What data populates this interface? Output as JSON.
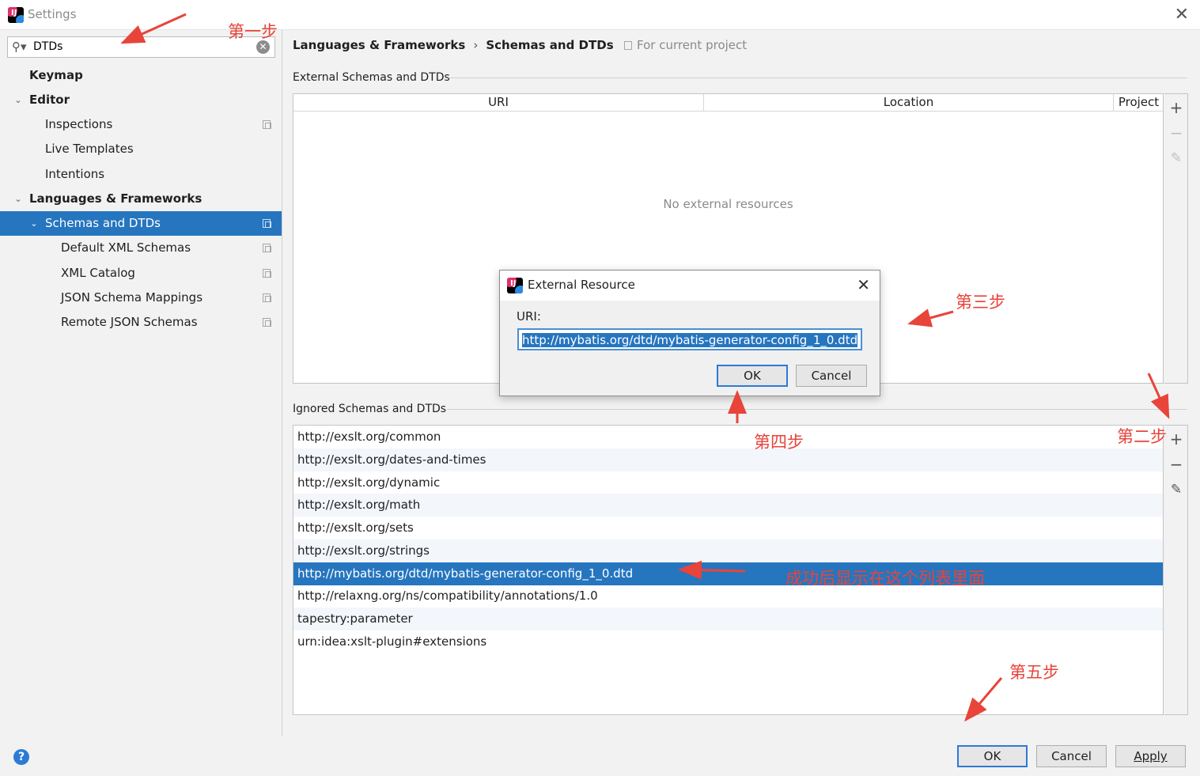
{
  "window": {
    "title": "Settings",
    "app_icon": "intellij-icon",
    "close_icon": "close-icon"
  },
  "sidebar": {
    "search_value": "DTDs",
    "items": [
      {
        "label": "Keymap"
      },
      {
        "label": "Editor"
      },
      {
        "label": "Inspections"
      },
      {
        "label": "Live Templates"
      },
      {
        "label": "Intentions"
      },
      {
        "label": "Languages & Frameworks"
      },
      {
        "label": "Schemas and DTDs"
      },
      {
        "label": "Default XML Schemas"
      },
      {
        "label": "XML Catalog"
      },
      {
        "label": "JSON Schema Mappings"
      },
      {
        "label": "Remote JSON Schemas"
      }
    ]
  },
  "header": {
    "breadcrumb_parent": "Languages & Frameworks",
    "breadcrumb_separator": "›",
    "breadcrumb_current": "Schemas and DTDs",
    "for_project": "For current project"
  },
  "external": {
    "title": "External Schemas and DTDs",
    "columns": [
      "URI",
      "Location",
      "Project"
    ],
    "empty_text": "No external resources"
  },
  "ignored": {
    "title": "Ignored Schemas and DTDs",
    "rows": [
      "http://exslt.org/common",
      "http://exslt.org/dates-and-times",
      "http://exslt.org/dynamic",
      "http://exslt.org/math",
      "http://exslt.org/sets",
      "http://exslt.org/strings",
      "http://mybatis.org/dtd/mybatis-generator-config_1_0.dtd",
      "http://relaxng.org/ns/compatibility/annotations/1.0",
      "tapestry:parameter",
      "urn:idea:xslt-plugin#extensions"
    ],
    "selected_index": 6
  },
  "toolbar": {
    "add": "+",
    "remove": "−",
    "edit": "✎"
  },
  "dialog": {
    "title": "External Resource",
    "uri_label": "URI:",
    "uri_value": "http://mybatis.org/dtd/mybatis-generator-config_1_0.dtd",
    "ok": "OK",
    "cancel": "Cancel"
  },
  "footer": {
    "help": "?",
    "ok": "OK",
    "cancel": "Cancel",
    "apply": "Apply"
  },
  "annotations": {
    "step1": "第一步",
    "step2": "第二步",
    "step3": "第三步",
    "step4": "第四步",
    "step5": "第五步",
    "success_note": "成功后显示在这个列表里面"
  },
  "colors": {
    "selection": "#2675bf",
    "annotation": "#e8443a",
    "primary_border": "#2d7ad6"
  }
}
